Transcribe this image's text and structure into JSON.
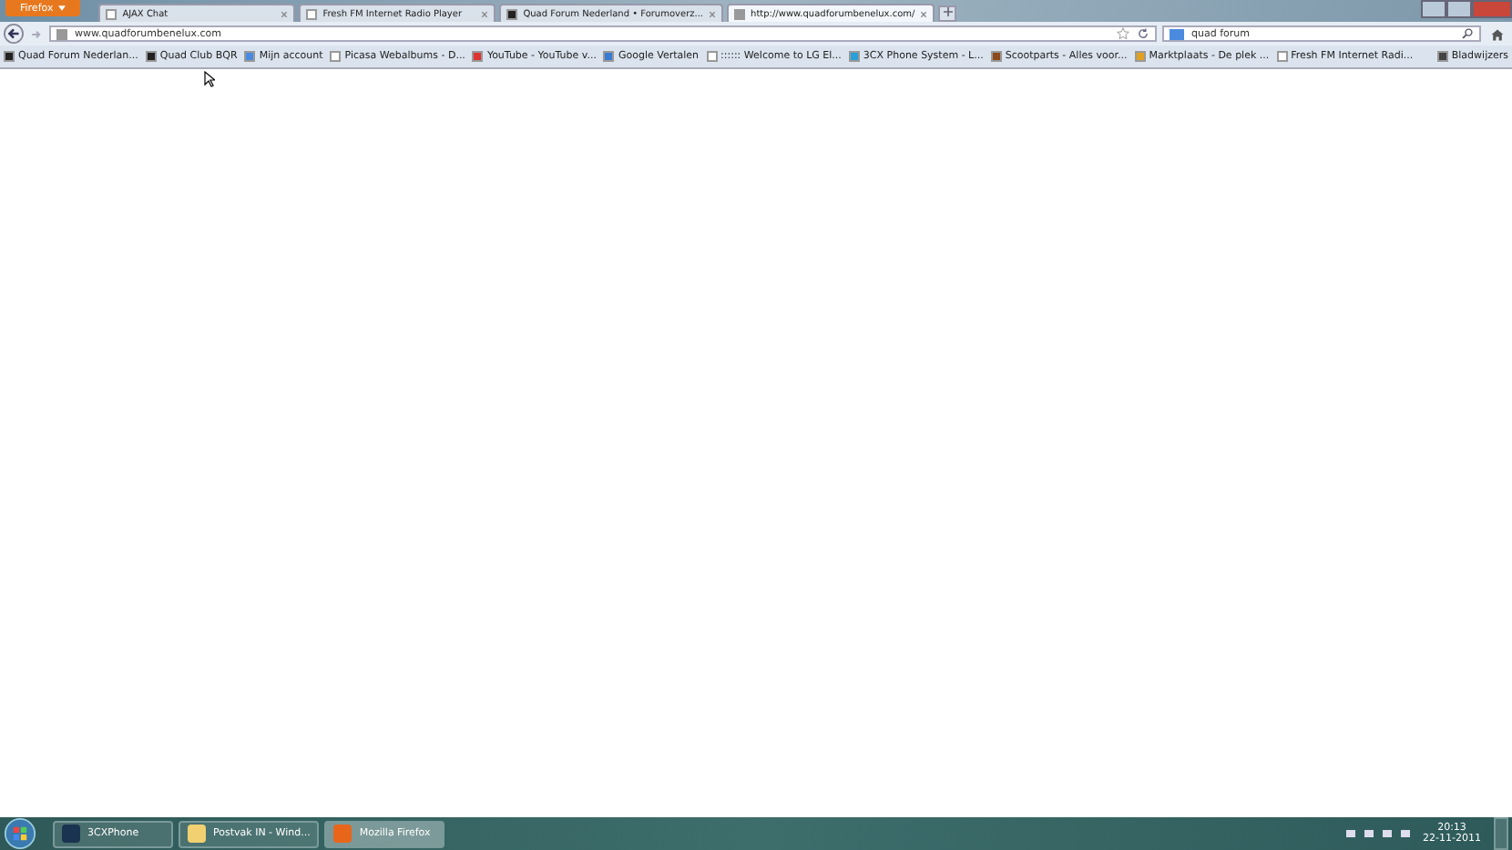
{
  "app_button": {
    "label": "Firefox"
  },
  "tabs": [
    {
      "title": "AJAX Chat",
      "kind": "page",
      "selected": false
    },
    {
      "title": "Fresh FM Internet Radio Player",
      "kind": "page",
      "selected": false
    },
    {
      "title": "Quad Forum Nederland • Forumoverz...",
      "kind": "quad",
      "selected": false
    },
    {
      "title": "http://www.quadforumbenelux.com/",
      "kind": "load",
      "selected": true
    }
  ],
  "address_bar": {
    "value": "www.quadforumbenelux.com"
  },
  "search_field": {
    "value": "quad forum"
  },
  "bookmarks": [
    {
      "label": "Quad Forum Nederlan...",
      "kind": "quad"
    },
    {
      "label": "Quad Club BQR",
      "kind": "quad"
    },
    {
      "label": "Mijn account",
      "kind": "google"
    },
    {
      "label": "Picasa Webalbums - D...",
      "kind": "page"
    },
    {
      "label": "YouTube - YouTube v...",
      "kind": "youtube"
    },
    {
      "label": "Google Vertalen",
      "kind": "translate"
    },
    {
      "label": ":::::: Welcome to LG El...",
      "kind": "page"
    },
    {
      "label": "3CX Phone System - L...",
      "kind": "phone"
    },
    {
      "label": "Scootparts - Alles voor...",
      "kind": "scoot"
    },
    {
      "label": "Marktplaats - De plek ...",
      "kind": "markt"
    },
    {
      "label": "Fresh FM Internet Radi...",
      "kind": "page"
    }
  ],
  "bookmarks_menu": {
    "label": "Bladwijzers"
  },
  "taskbar": {
    "items": [
      {
        "label": "3CXPhone",
        "kind": "phone",
        "selected": false
      },
      {
        "label": "Postvak IN - Wind...",
        "kind": "mail",
        "selected": false
      },
      {
        "label": "Mozilla Firefox",
        "kind": "firefox",
        "selected": true
      }
    ],
    "clock": {
      "time": "20:13",
      "date": "22-11-2011"
    }
  }
}
